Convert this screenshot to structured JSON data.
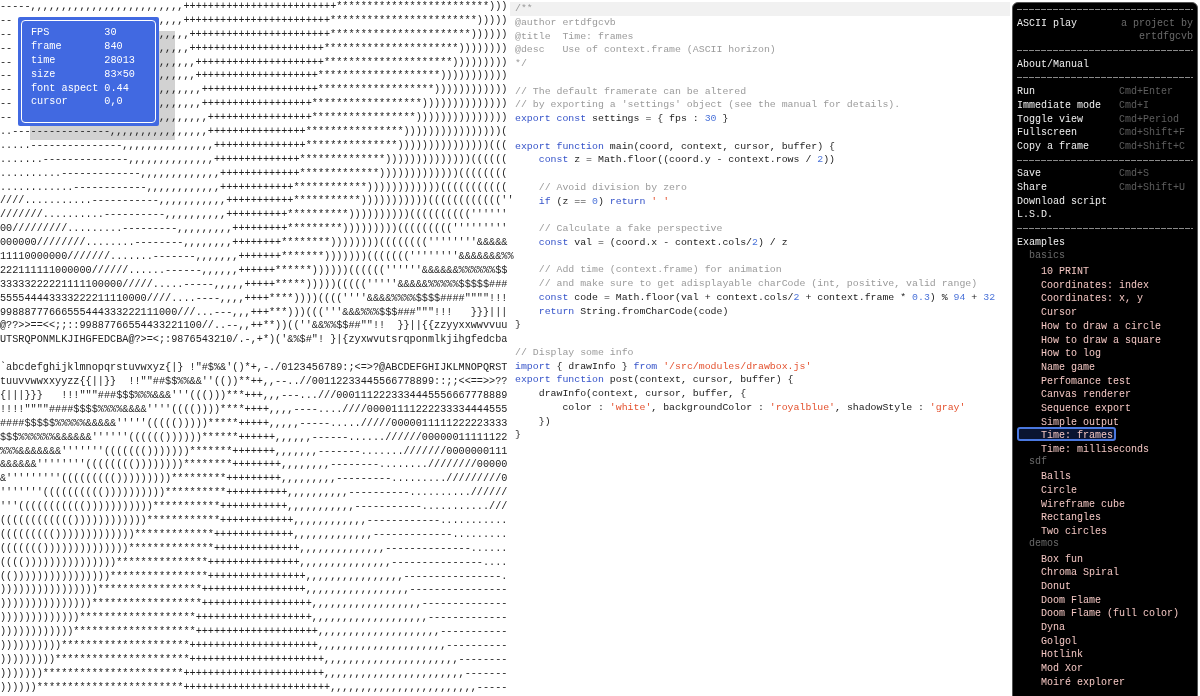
{
  "canvas": {
    "info_panel": [
      {
        "label": "FPS",
        "value": "30"
      },
      {
        "label": "frame",
        "value": "840"
      },
      {
        "label": "time",
        "value": "28013"
      },
      {
        "label": "size",
        "value": "83×50"
      },
      {
        "label": "font aspect",
        "value": "0.44"
      },
      {
        "label": "cursor",
        "value": "0,0"
      }
    ],
    "upper_rows": [
      {
        "kind": "full",
        "text": "-----,,,,,,,,,,,,,,,,,,,,,,,,,+++++++++++++++++++++++++*************************)))"
      },
      {
        "kind": "covered",
        "before": "--",
        "after": ",,,,++++++++++++++++++++++++************************)))))"
      },
      {
        "kind": "covered",
        "before": "--",
        "after": ",,,,,+++++++++++++++++++++++***********************))))))"
      },
      {
        "kind": "covered",
        "before": "--",
        "after": ",,,,,++++++++++++++++++++++**********************))))))))"
      },
      {
        "kind": "covered",
        "before": "--",
        "after": ",,,,,,+++++++++++++++++++++*********************)))))))))"
      },
      {
        "kind": "covered",
        "before": "--",
        "after": ",,,,,,++++++++++++++++++++********************)))))))))))"
      },
      {
        "kind": "covered",
        "before": "--",
        "after": ",,,,,,,+++++++++++++++++++*******************))))))))))))"
      },
      {
        "kind": "covered",
        "before": "--",
        "after": ",,,,,,,++++++++++++++++++******************))))))))))))))"
      },
      {
        "kind": "covered",
        "before": "--",
        "after": ",,,,,,,,+++++++++++++++++*****************)))))))))))))))"
      },
      {
        "kind": "full",
        "text": "..----------------,,,,,,,,,,,,,,,,++++++++++++++++****************))))))))))))))))("
      },
      {
        "kind": "full",
        "text": ".....---------------,,,,,,,,,,,,,,,+++++++++++++++***************)))))))))))))))((("
      },
      {
        "kind": "full",
        "text": ".......--------------,,,,,,,,,,,,,,++++++++++++++**************))))))))))))))(((((("
      },
      {
        "kind": "full",
        "text": "..........-------------,,,,,,,,,,,,,+++++++++++++*************)))))))))))))(((((((("
      },
      {
        "kind": "full",
        "text": "............------------,,,,,,,,,,,,++++++++++++************))))))))))))((((((((((("
      },
      {
        "kind": "full",
        "text": "////...........-----------,,,,,,,,,,,+++++++++++***********)))))))))))((((((((((((''"
      },
      {
        "kind": "full",
        "text": "///////..........----------,,,,,,,,,,++++++++++**********))))))))))((((((((((''''''"
      },
      {
        "kind": "full",
        "text": "00/////////.........---------,,,,,,,,,+++++++++*********)))))))))((((((((('''''''''"
      },
      {
        "kind": "full",
        "text": "000000////////........--------,,,,,,,,++++++++********))))))))((((((((''''''''&&&&&"
      },
      {
        "kind": "full",
        "text": "11110000000///////.......-------,,,,,,,+++++++*******)))))))(((((((''''''''&&&&&&&%%"
      },
      {
        "kind": "full",
        "text": "222111111000000//////......------,,,,,,++++++******))))))((((((''''''&&&&&&%%%%%%$$"
      },
      {
        "kind": "full",
        "text": "33333222221111100000/////.....-----,,,,,+++++*****)))))((((('''''&&&&&%%%%%$$$$$###"
      },
      {
        "kind": "full",
        "text": "555544443333222211110000////....----,,,,++++****))))((((''''&&&&%%%%$$$$####\"\"\"\"!!!"
      },
      {
        "kind": "full",
        "text": "99888777666555444333222111000///...---,,,+++***)))((('''&&&%%%$$$###\"\"\"!!!   }}}|||"
      },
      {
        "kind": "full",
        "text": "@??>>==<<;;::99887766554433221100//..--,,++**))((''&&%%$$##\"\"!!  }}||{{zzyyxxwwvvuu"
      },
      {
        "kind": "full",
        "text": "UTSRQPONMLKJIHGFEDCBA@?>=<;:9876543210/.-,+*)('&%$#\"! }|{zyxwvutsrqponmlkjihgfedcba"
      }
    ],
    "lower_rows": [
      {
        "kind": "full",
        "text": "`abcdefghijklmnopqrstuvwxyz{|} !\"#$%&'()*+,-./0123456789:;<=>?@ABCDEFGHIJKLMNOPQRST"
      },
      {
        "kind": "full",
        "text": "tuuvvwwxxyyzz{{||}}  !!\"\"##$$%%&&''(())**++,,--..//00112233445566778899::;;<<==>>??"
      },
      {
        "kind": "full",
        "text": "{|||}}}   !!!\"\"\"###$$$%%%&&&'''((()))***+++,,,---...///0001112223334445556667778889"
      },
      {
        "kind": "full",
        "text": "!!!!\"\"\"\"####$$$$%%%%&&&&''''(((())))****++++,,,,----....////00001111222233334444555"
      },
      {
        "kind": "full",
        "text": "####$$$$$%%%%%&&&&&'''''((((()))))*****+++++,,,,,-----...../////0000011111222223333"
      },
      {
        "kind": "full",
        "text": "$$$%%%%%%&&&&&&''''''(((((())))))******++++++,,,,,,------......//////00000011111122"
      },
      {
        "kind": "full",
        "text": "%%%&&&&&&&'''''''((((((()))))))*******+++++++,,,,,,,-------.......///////0000000111"
      },
      {
        "kind": "full",
        "text": "&&&&&&''''''''(((((((())))))))********++++++++,,,,,,,,--------........////////00000"
      },
      {
        "kind": "full",
        "text": "&'''''''''((((((((()))))))))*********+++++++++,,,,,,,,,---------........./////////0"
      },
      {
        "kind": "full",
        "text": "'''''''(((((((((())))))))))**********++++++++++,,,,,,,,,,----------..........//////"
      },
      {
        "kind": "full",
        "text": "'''((((((((((()))))))))))***********+++++++++++,,,,,,,,,,,-----------...........///"
      },
      {
        "kind": "full",
        "text": "(((((((((((())))))))))))************++++++++++++,,,,,,,,,,,,------------..........."
      },
      {
        "kind": "full",
        "text": "((((((((()))))))))))))*************+++++++++++++,,,,,,,,,,,,,-------------........."
      },
      {
        "kind": "full",
        "text": "((((((())))))))))))))**************++++++++++++++,,,,,,,,,,,,,,--------------......"
      },
      {
        "kind": "full",
        "text": "(((()))))))))))))))***************+++++++++++++++,,,,,,,,,,,,,,,---------------...."
      },
      {
        "kind": "full",
        "text": "(())))))))))))))))****************++++++++++++++++,,,,,,,,,,,,,,,,----------------."
      },
      {
        "kind": "full",
        "text": "))))))))))))))))*****************+++++++++++++++++,,,,,,,,,,,,,,,,,----------------"
      },
      {
        "kind": "full",
        "text": ")))))))))))))))******************++++++++++++++++++,,,,,,,,,,,,,,,,,,--------------"
      },
      {
        "kind": "full",
        "text": ")))))))))))))*******************+++++++++++++++++++,,,,,,,,,,,,,,,,,,,-------------"
      },
      {
        "kind": "full",
        "text": "))))))))))))********************++++++++++++++++++++,,,,,,,,,,,,,,,,,,,,-----------"
      },
      {
        "kind": "full",
        "text": "))))))))))*********************+++++++++++++++++++++,,,,,,,,,,,,,,,,,,,,,----------"
      },
      {
        "kind": "full",
        "text": ")))))))))**********************++++++++++++++++++++++,,,,,,,,,,,,,,,,,,,,,,--------"
      },
      {
        "kind": "full",
        "text": ")))))))***********************+++++++++++++++++++++++,,,,,,,,,,,,,,,,,,,,,,,-------"
      },
      {
        "kind": "full",
        "text": "))))))************************++++++++++++++++++++++++,,,,,,,,,,,,,,,,,,,,,,,,-----"
      }
    ]
  },
  "editor": {
    "lines": [
      {
        "kind": "code",
        "active": true,
        "tokens": [
          {
            "text": "/**",
            "kind": "comment"
          }
        ]
      },
      {
        "kind": "code",
        "active": false,
        "tokens": [
          {
            "text": "@author ertdfgcvb",
            "kind": "comment"
          }
        ]
      },
      {
        "kind": "code",
        "active": false,
        "tokens": [
          {
            "text": "@title  Time: frames",
            "kind": "comment"
          }
        ]
      },
      {
        "kind": "code",
        "active": false,
        "tokens": [
          {
            "text": "@desc   Use of context.frame (ASCII horizon)",
            "kind": "comment"
          }
        ]
      },
      {
        "kind": "code",
        "active": false,
        "tokens": [
          {
            "text": "*/",
            "kind": "comment"
          }
        ]
      },
      {
        "kind": "blank",
        "active": false
      },
      {
        "kind": "code",
        "active": false,
        "tokens": [
          {
            "text": "// The default framerate can be altered",
            "kind": "comment"
          }
        ]
      },
      {
        "kind": "code",
        "active": false,
        "tokens": [
          {
            "text": "// by exporting a 'settings' object (see the manual for details).",
            "kind": "comment"
          }
        ]
      },
      {
        "kind": "code",
        "active": false,
        "tokens": [
          {
            "text": "export const",
            "kind": "keyword"
          },
          {
            "text": " settings = { fps : ",
            "kind": "plain"
          },
          {
            "text": "30",
            "kind": "number"
          },
          {
            "text": " }",
            "kind": "plain"
          }
        ]
      },
      {
        "kind": "blank",
        "active": false
      },
      {
        "kind": "code",
        "active": false,
        "tokens": [
          {
            "text": "export function",
            "kind": "keyword"
          },
          {
            "text": " main(coord, context, cursor, buffer) {",
            "kind": "plain"
          }
        ]
      },
      {
        "kind": "code",
        "active": false,
        "tokens": [
          {
            "text": "    const",
            "kind": "keyword"
          },
          {
            "text": " z = Math.floor((coord.y - context.rows / ",
            "kind": "plain"
          },
          {
            "text": "2",
            "kind": "number"
          },
          {
            "text": "))",
            "kind": "plain"
          }
        ]
      },
      {
        "kind": "blank",
        "active": false
      },
      {
        "kind": "code",
        "active": false,
        "tokens": [
          {
            "text": "    // Avoid division by zero",
            "kind": "comment"
          }
        ]
      },
      {
        "kind": "code",
        "active": false,
        "tokens": [
          {
            "text": "    if",
            "kind": "keyword"
          },
          {
            "text": " (z == ",
            "kind": "plain"
          },
          {
            "text": "0",
            "kind": "number"
          },
          {
            "text": ") ",
            "kind": "plain"
          },
          {
            "text": "return ",
            "kind": "keyword"
          },
          {
            "text": "' '",
            "kind": "string"
          }
        ]
      },
      {
        "kind": "blank",
        "active": false
      },
      {
        "kind": "code",
        "active": false,
        "tokens": [
          {
            "text": "    // Calculate a fake perspective",
            "kind": "comment"
          }
        ]
      },
      {
        "kind": "code",
        "active": false,
        "tokens": [
          {
            "text": "    const",
            "kind": "keyword"
          },
          {
            "text": " val = (coord.x - context.cols/",
            "kind": "plain"
          },
          {
            "text": "2",
            "kind": "number"
          },
          {
            "text": ") / z",
            "kind": "plain"
          }
        ]
      },
      {
        "kind": "blank",
        "active": false
      },
      {
        "kind": "code",
        "active": false,
        "tokens": [
          {
            "text": "    // Add time (context.frame) for animation",
            "kind": "comment"
          }
        ]
      },
      {
        "kind": "code",
        "active": false,
        "tokens": [
          {
            "text": "    // and make sure to get adisplayable charCode (int, positive, valid range)",
            "kind": "comment"
          }
        ]
      },
      {
        "kind": "code",
        "active": false,
        "tokens": [
          {
            "text": "    const",
            "kind": "keyword"
          },
          {
            "text": " code = Math.floor(val + context.cols/",
            "kind": "plain"
          },
          {
            "text": "2",
            "kind": "number"
          },
          {
            "text": " + context.frame * ",
            "kind": "plain"
          },
          {
            "text": "0.3",
            "kind": "number"
          },
          {
            "text": ") % ",
            "kind": "plain"
          },
          {
            "text": "94",
            "kind": "number"
          },
          {
            "text": " + ",
            "kind": "plain"
          },
          {
            "text": "32",
            "kind": "number"
          }
        ]
      },
      {
        "kind": "code",
        "active": false,
        "tokens": [
          {
            "text": "    return",
            "kind": "keyword"
          },
          {
            "text": " String.fromCharCode(code)",
            "kind": "plain"
          }
        ]
      },
      {
        "kind": "code",
        "active": false,
        "tokens": [
          {
            "text": "}",
            "kind": "plain"
          }
        ]
      },
      {
        "kind": "blank",
        "active": false
      },
      {
        "kind": "code",
        "active": false,
        "tokens": [
          {
            "text": "// Display some info",
            "kind": "comment"
          }
        ]
      },
      {
        "kind": "code",
        "active": false,
        "tokens": [
          {
            "text": "import",
            "kind": "keyword"
          },
          {
            "text": " { drawInfo } ",
            "kind": "plain"
          },
          {
            "text": "from ",
            "kind": "keyword"
          },
          {
            "text": "'/src/modules/drawbox.js'",
            "kind": "string"
          }
        ]
      },
      {
        "kind": "code",
        "active": false,
        "tokens": [
          {
            "text": "export function",
            "kind": "keyword"
          },
          {
            "text": " post(context, cursor, buffer) {",
            "kind": "plain"
          }
        ]
      },
      {
        "kind": "code",
        "active": false,
        "tokens": [
          {
            "text": "    drawInfo(context, cursor, buffer, {",
            "kind": "plain"
          }
        ]
      },
      {
        "kind": "code",
        "active": false,
        "tokens": [
          {
            "text": "        color : ",
            "kind": "plain"
          },
          {
            "text": "'white'",
            "kind": "string"
          },
          {
            "text": ", backgroundColor : ",
            "kind": "plain"
          },
          {
            "text": "'royalblue'",
            "kind": "string"
          },
          {
            "text": ", shadowStyle : ",
            "kind": "plain"
          },
          {
            "text": "'gray'",
            "kind": "string"
          }
        ]
      },
      {
        "kind": "code",
        "active": false,
        "tokens": [
          {
            "text": "    })",
            "kind": "plain"
          }
        ]
      },
      {
        "kind": "code",
        "active": false,
        "tokens": [
          {
            "text": "}",
            "kind": "plain"
          }
        ]
      }
    ]
  },
  "menu": {
    "title": "ASCII play",
    "byline": "a project by ertdfgcvb",
    "groups": [
      {
        "items": [
          {
            "label": "About/Manual"
          }
        ]
      },
      {
        "items": [
          {
            "label": "Run",
            "shortcut": "Cmd+Enter"
          },
          {
            "label": "Immediate mode",
            "shortcut": "Cmd+I"
          },
          {
            "label": "Toggle view",
            "shortcut": "Cmd+Period"
          },
          {
            "label": "Fullscreen",
            "shortcut": "Cmd+Shift+F"
          },
          {
            "label": "Copy a frame",
            "shortcut": "Cmd+Shift+C"
          }
        ]
      },
      {
        "items": [
          {
            "label": "Save",
            "shortcut": "Cmd+S"
          },
          {
            "label": "Share",
            "shortcut": "Cmd+Shift+U"
          },
          {
            "label": "Download script"
          },
          {
            "label": "L.S.D."
          }
        ]
      }
    ],
    "examples": {
      "label": "Examples",
      "categories": [
        {
          "label": "basics",
          "items": [
            {
              "label": "10 PRINT",
              "selected": false
            },
            {
              "label": "Coordinates: index",
              "selected": false
            },
            {
              "label": "Coordinates: x, y",
              "selected": false
            },
            {
              "label": "Cursor",
              "selected": false
            },
            {
              "label": "How to draw a circle",
              "selected": false
            },
            {
              "label": "How to draw a square",
              "selected": false
            },
            {
              "label": "How to log",
              "selected": false
            },
            {
              "label": "Name game",
              "selected": false
            },
            {
              "label": "Perfomance test",
              "selected": false
            },
            {
              "label": "Canvas renderer",
              "selected": false
            },
            {
              "label": "Sequence export",
              "selected": false
            },
            {
              "label": "Simple output",
              "selected": false
            },
            {
              "label": "Time: frames",
              "selected": true
            },
            {
              "label": "Time: milliseconds",
              "selected": false
            }
          ]
        },
        {
          "label": "sdf",
          "items": [
            {
              "label": "Balls",
              "selected": false
            },
            {
              "label": "Circle",
              "selected": false
            },
            {
              "label": "Wireframe cube",
              "selected": false
            },
            {
              "label": "Rectangles",
              "selected": false
            },
            {
              "label": "Two circles",
              "selected": false
            }
          ]
        },
        {
          "label": "demos",
          "items": [
            {
              "label": "Box fun",
              "selected": false
            },
            {
              "label": "Chroma Spiral",
              "selected": false
            },
            {
              "label": "Donut",
              "selected": false
            },
            {
              "label": "Doom Flame",
              "selected": false
            },
            {
              "label": "Doom Flame (full color)",
              "selected": false
            },
            {
              "label": "Dyna",
              "selected": false
            },
            {
              "label": "Golgol",
              "selected": false
            },
            {
              "label": "Hotlink",
              "selected": false
            },
            {
              "label": "Mod Xor",
              "selected": false
            },
            {
              "label": "Moiré explorer",
              "selected": false
            }
          ]
        }
      ]
    }
  }
}
